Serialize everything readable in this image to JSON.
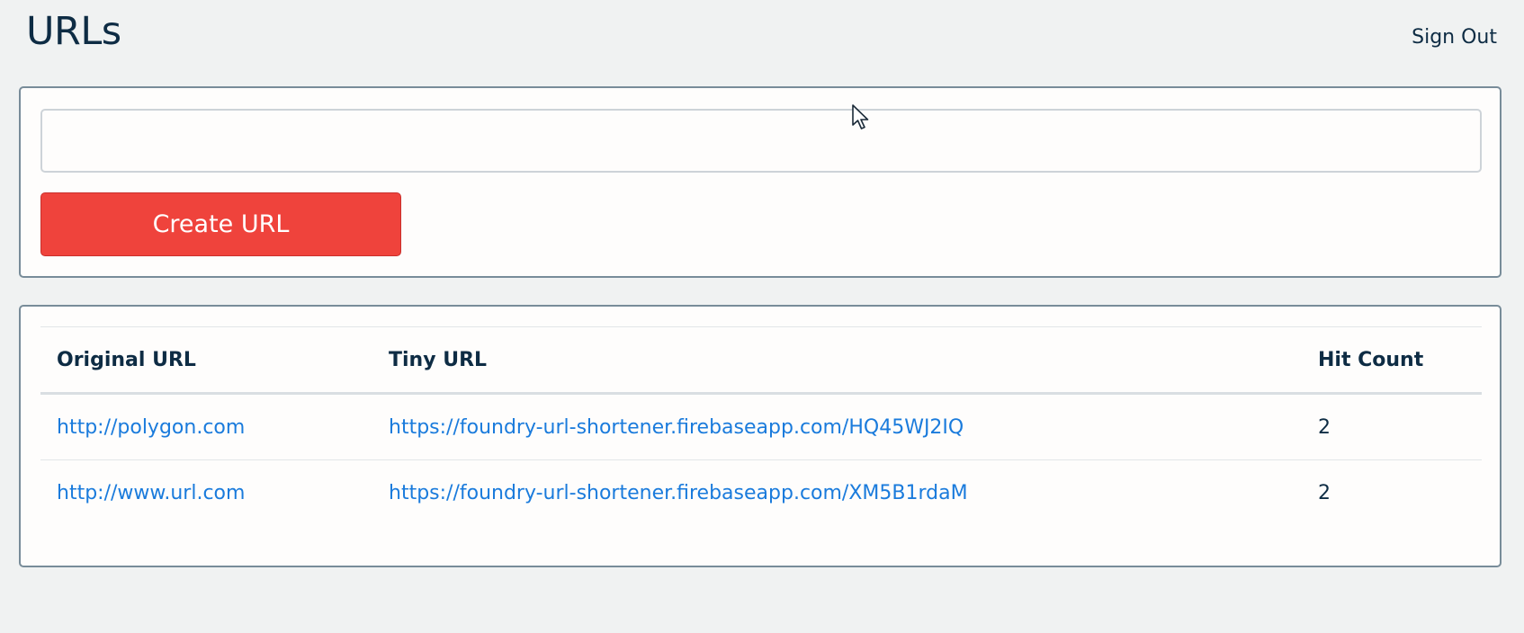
{
  "header": {
    "title": "URLs",
    "sign_out_label": "Sign Out"
  },
  "create_form": {
    "input_value": "",
    "input_placeholder": "",
    "button_label": "Create URL"
  },
  "table": {
    "columns": [
      "Original URL",
      "Tiny URL",
      "Hit Count"
    ],
    "rows": [
      {
        "original_url": "http://polygon.com",
        "tiny_url": "https://foundry-url-shortener.firebaseapp.com/HQ45WJ2IQ",
        "hit_count": "2"
      },
      {
        "original_url": "http://www.url.com",
        "tiny_url": "https://foundry-url-shortener.firebaseapp.com/XM5B1rdaM",
        "hit_count": "2"
      }
    ]
  },
  "colors": {
    "background": "#f0f2f2",
    "card_background": "#fefdfc",
    "card_border": "#788c99",
    "button_red": "#ef433c",
    "link_blue": "#1a7bdc",
    "text_dark": "#0e2c44"
  },
  "icons": {
    "cursor": "mouse-pointer-icon"
  }
}
